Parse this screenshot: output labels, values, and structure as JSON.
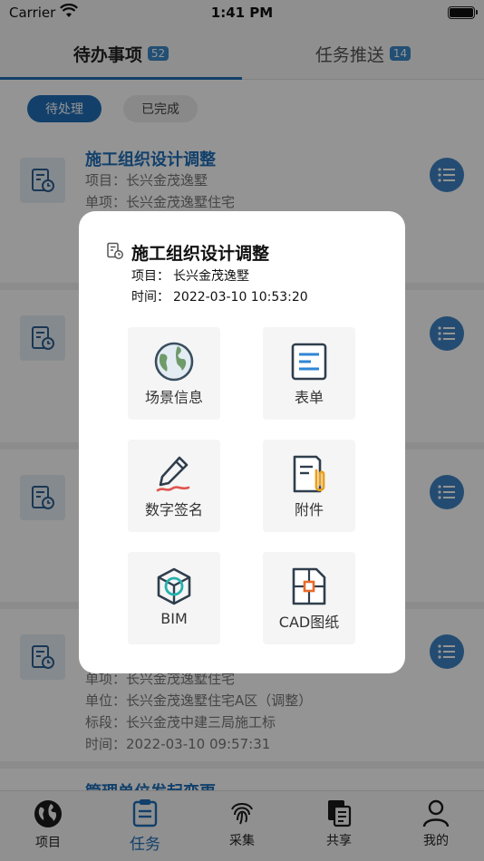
{
  "status_bar": {
    "carrier": "Carrier",
    "time": "1:41 PM"
  },
  "top_tabs": [
    {
      "label": "待办事项",
      "count": "52"
    },
    {
      "label": "任务推送",
      "count": "14"
    }
  ],
  "filters": [
    {
      "label": "待处理",
      "active": true
    },
    {
      "label": "已完成",
      "active": false
    }
  ],
  "tasks": [
    {
      "title": "施工组织设计调整",
      "project_label": "项目：",
      "project": "长兴金茂逸墅",
      "item_label": "单项：",
      "item": "长兴金茂逸墅住宅"
    },
    {},
    {},
    {
      "item_label": "单项：",
      "item": "长兴金茂逸墅住宅",
      "unit_label": "单位：",
      "unit": "长兴金茂逸墅住宅A区（调整）",
      "section_label": "标段：",
      "section": "长兴金茂中建三局施工标",
      "time_label": "时间：",
      "time": "2022-03-10 09:57:31"
    },
    {
      "title": "管理单位发起变更"
    }
  ],
  "modal": {
    "title": "施工组织设计调整",
    "project_label": "项目：",
    "project": "长兴金茂逸墅",
    "time_label": "时间：",
    "time": "2022-03-10 10:53:20",
    "actions": [
      {
        "label": "场景信息",
        "icon": "globe-icon"
      },
      {
        "label": "表单",
        "icon": "form-icon"
      },
      {
        "label": "数字签名",
        "icon": "signature-pen-icon"
      },
      {
        "label": "附件",
        "icon": "attachment-icon"
      },
      {
        "label": "BIM",
        "icon": "bim-cube-icon"
      },
      {
        "label": "CAD图纸",
        "icon": "cad-drawing-icon"
      }
    ]
  },
  "bottom_nav": [
    {
      "label": "项目",
      "icon": "globe-icon"
    },
    {
      "label": "任务",
      "icon": "clipboard-icon",
      "active": true
    },
    {
      "label": "采集",
      "icon": "fingerprint-icon"
    },
    {
      "label": "共享",
      "icon": "share-docs-icon"
    },
    {
      "label": "我的",
      "icon": "user-icon"
    }
  ],
  "colors": {
    "accent": "#1f6fb8",
    "badge": "#3c88c8",
    "menu_button": "#3f84c4",
    "overlay": "rgba(0,0,0,0.42)"
  }
}
